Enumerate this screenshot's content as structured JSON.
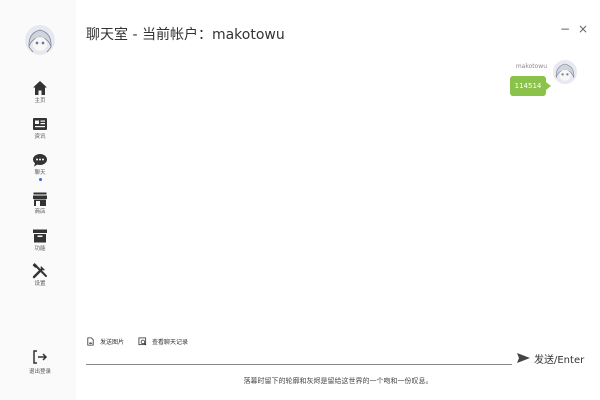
{
  "window": {
    "title": "聊天室 - 当前帐户：makotowu",
    "minimize_label": "−",
    "close_label": "×"
  },
  "sidebar": {
    "avatar_icon": "anime-avatar-icon",
    "items": [
      {
        "label": "主页",
        "icon": "home-icon"
      },
      {
        "label": "资讯",
        "icon": "news-icon"
      },
      {
        "label": "聊天",
        "icon": "chat-icon",
        "active": true
      },
      {
        "label": "商店",
        "icon": "store-icon"
      },
      {
        "label": "功能",
        "icon": "archive-icon"
      },
      {
        "label": "设置",
        "icon": "tools-icon"
      }
    ],
    "logout_label": "退出登录"
  },
  "messages": [
    {
      "sender": "makotowu",
      "text": "114514",
      "bubble_color": "#8bc34a"
    }
  ],
  "toolbar": {
    "send_image_label": "发送图片",
    "history_label": "查看聊天记录"
  },
  "input": {
    "value": "",
    "send_label": "发送/Enter"
  },
  "footer": {
    "quote": "落幕时留下的轮廓和灰烬是留给这世界的一个吻和一份叹息。"
  },
  "colors": {
    "accent": "#2a6fd6",
    "bubble": "#8bc34a",
    "icon": "#333333"
  }
}
